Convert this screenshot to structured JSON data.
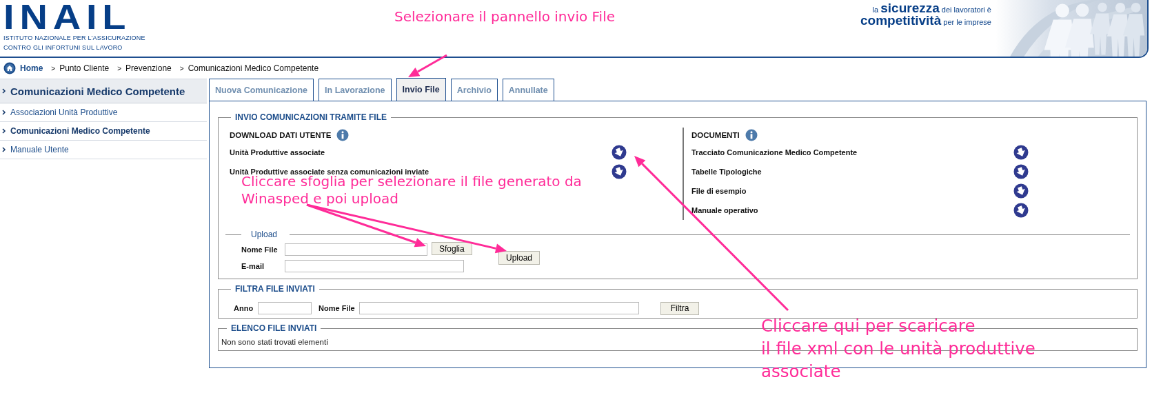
{
  "header": {
    "logo": "INAIL",
    "institute": [
      "ISTITUTO NAZIONALE PER L'ASSICURAZIONE",
      "CONTRO GLI INFORTUNI SUL LAVORO"
    ],
    "tagline": [
      "la **sicurezza** dei lavoratori è",
      "**competitività** per le imprese"
    ]
  },
  "breadcrumb": [
    {
      "label": "Home"
    },
    {
      "separator": ">",
      "label": "Punto Cliente"
    },
    {
      "separator": ">",
      "label": "Prevenzione"
    },
    {
      "separator": ">",
      "label": "Comunicazioni Medico Competente"
    }
  ],
  "sidebar": {
    "title": "Comunicazioni Medico Competente",
    "items": [
      {
        "label": "Associazioni Unità Produttive",
        "selected": false
      },
      {
        "label": "Comunicazioni Medico Competente",
        "selected": true
      },
      {
        "label": "Manuale Utente",
        "selected": false
      }
    ]
  },
  "tabs": [
    {
      "label": "Nuova Comunicazione",
      "selected": false
    },
    {
      "label": "In Lavorazione",
      "selected": false
    },
    {
      "label": "Invio File",
      "selected": true
    },
    {
      "label": "Archivio",
      "selected": false
    },
    {
      "label": "Annullate",
      "selected": false
    }
  ],
  "send_panel": {
    "legend": "INVIO COMUNICAZIONI TRAMITE FILE",
    "download": {
      "heading": "DOWNLOAD DATI UTENTE",
      "items": [
        "Unità Produttive associate",
        "Unità Produttive associate senza comunicazioni inviate"
      ]
    },
    "documents": {
      "heading": "DOCUMENTI",
      "items": [
        "Tracciato Comunicazione Medico Competente",
        "Tabelle Tipologiche",
        "File di esempio",
        "Manuale operativo"
      ]
    },
    "upload": {
      "legend": "Upload",
      "file_label": "Nome File",
      "browse_button": "Sfoglia",
      "email_label": "E-mail",
      "upload_button": "Upload"
    }
  },
  "filter": {
    "legend": "FILTRA FILE INVIATI",
    "year_label": "Anno",
    "name_label": "Nome File",
    "button": "Filtra"
  },
  "sent_list": {
    "legend": "ELENCO FILE INVIATI",
    "message": "Non sono stati trovati elementi"
  },
  "annotations": [
    {
      "lines": [
        "Selezionare il pannello invio File"
      ]
    },
    {
      "lines": [
        "Cliccare sfoglia per selezionare il file generato da",
        "Winasped e poi upload"
      ]
    },
    {
      "lines": [
        "Cliccare qui per scaricare",
        "il file xml con le unità produttive",
        "associate"
      ]
    }
  ]
}
